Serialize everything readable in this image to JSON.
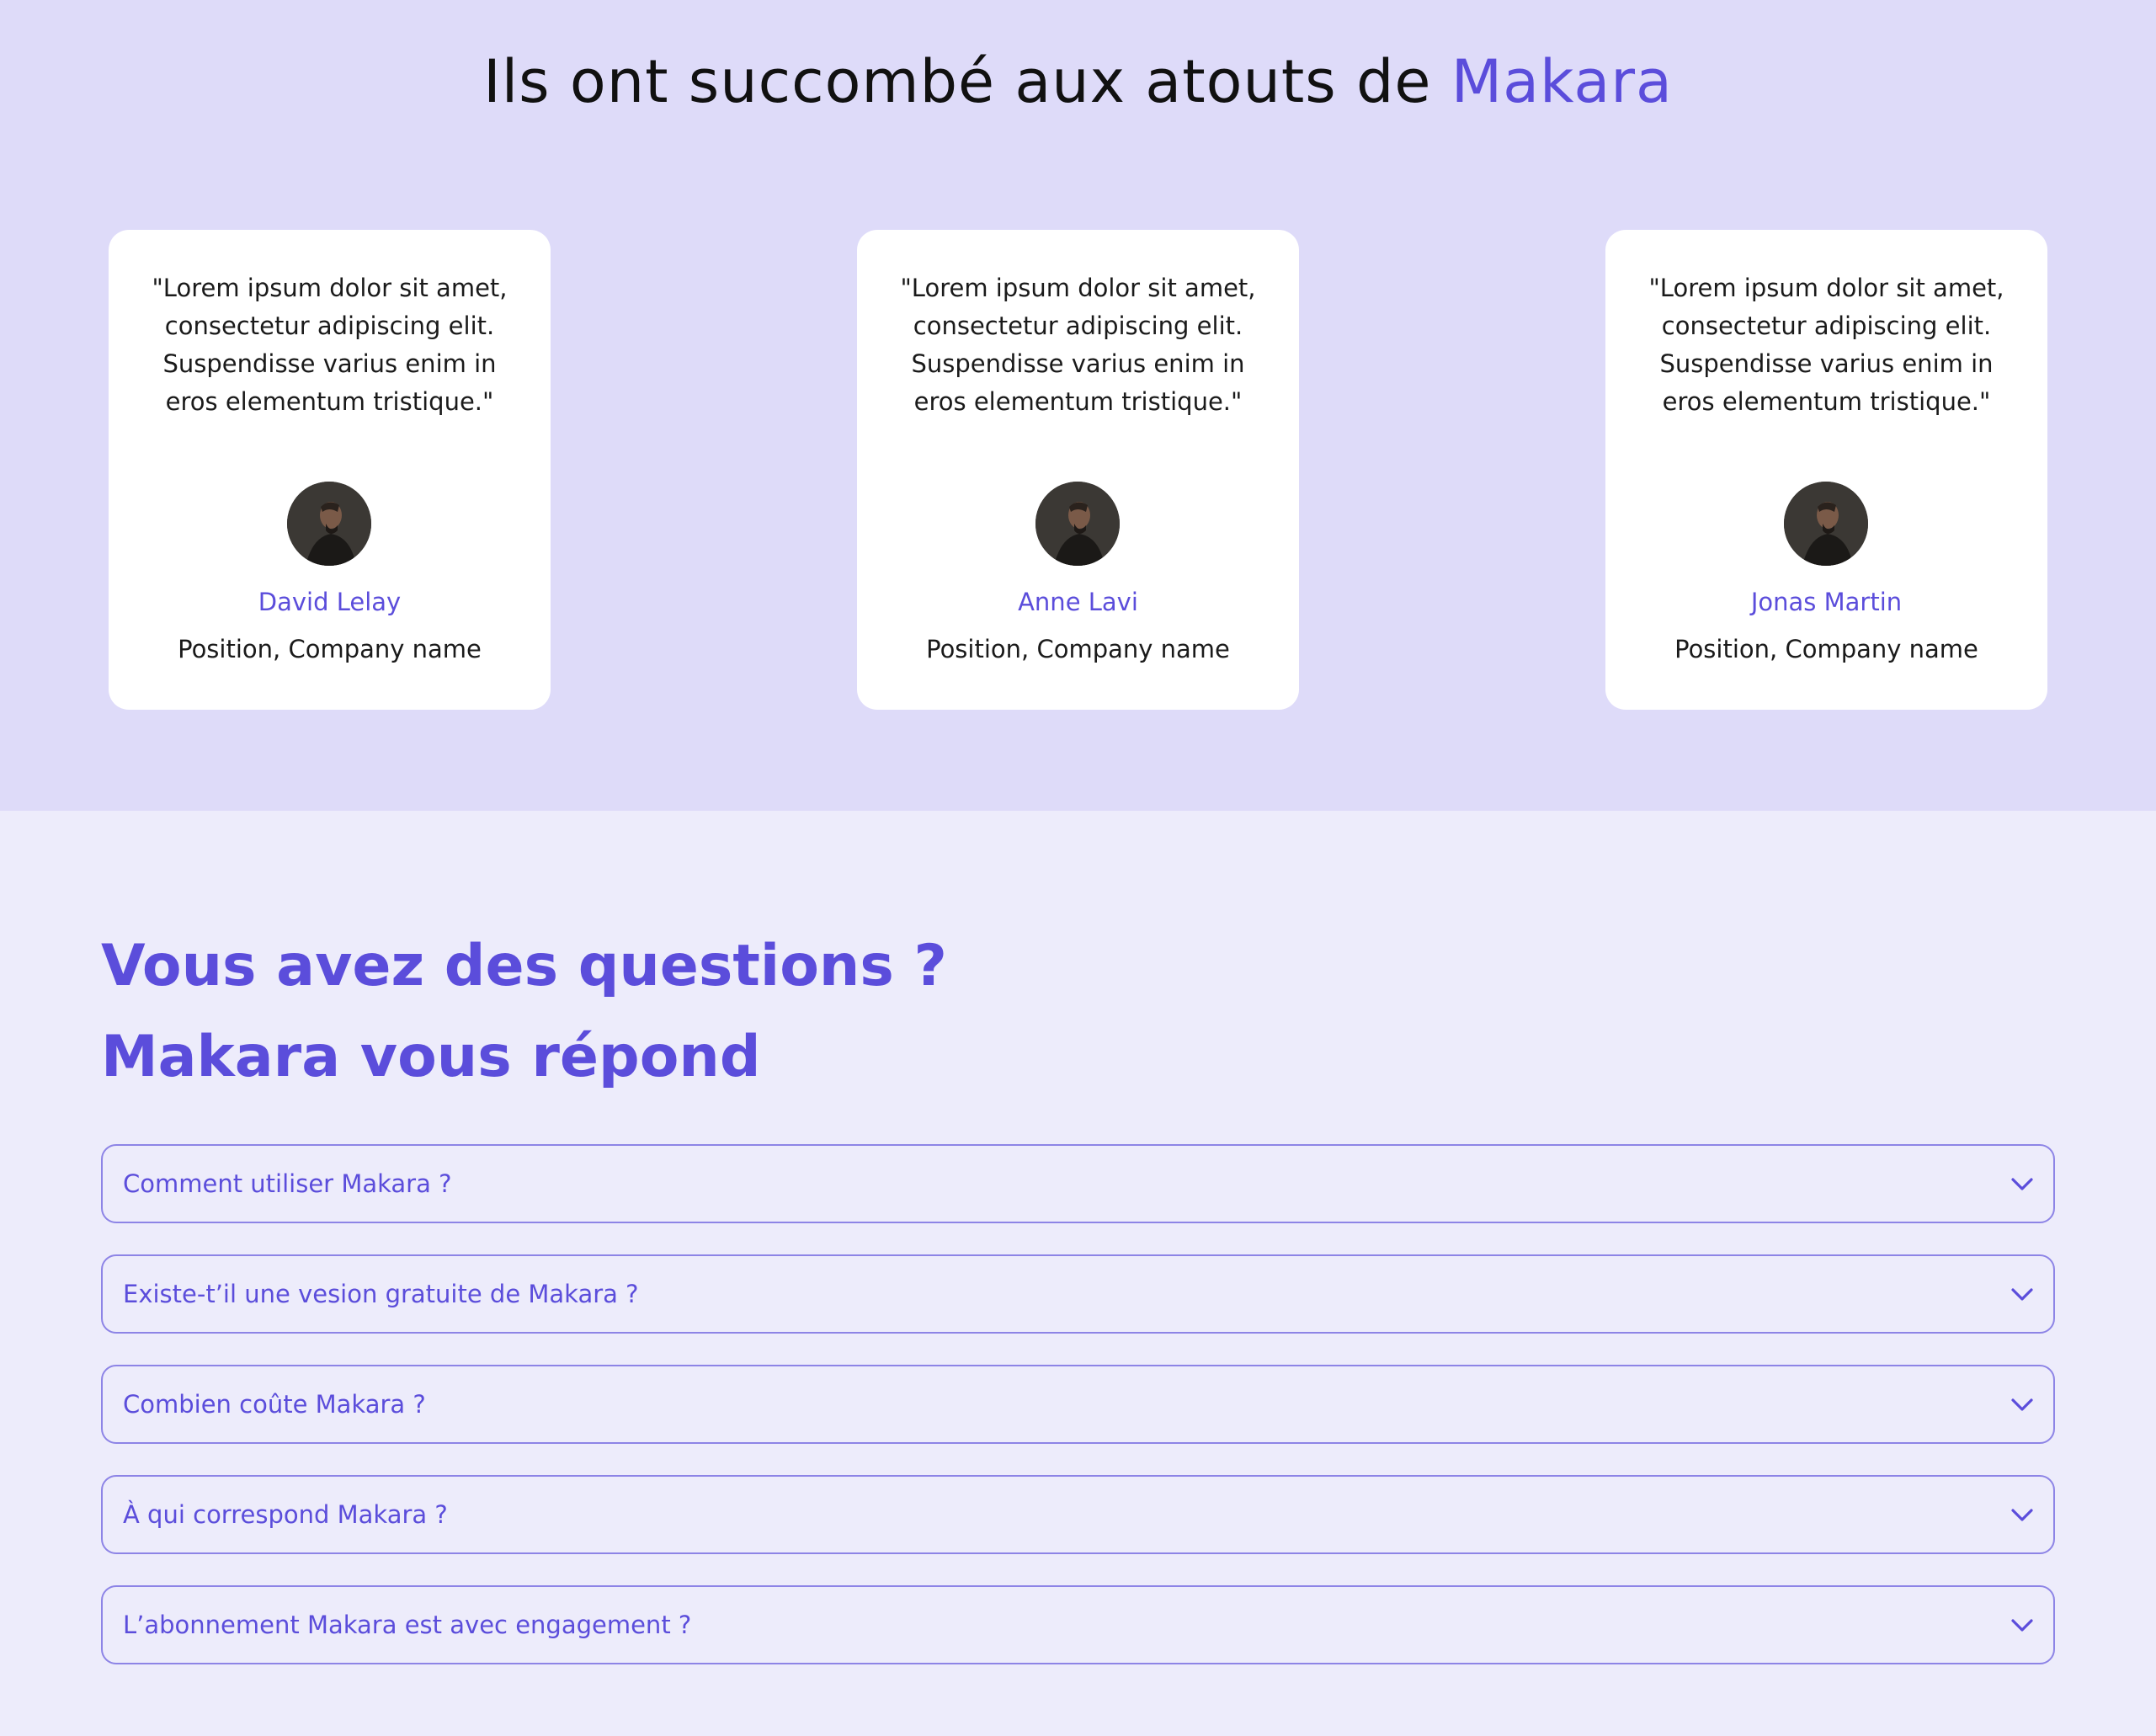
{
  "testimonials": {
    "title_prefix": "Ils ont succombé aux atouts de ",
    "title_brand": "Makara",
    "cards": [
      {
        "quote": "\"Lorem ipsum dolor sit amet, consectetur adipiscing elit. Suspendisse varius enim in eros elementum tristique.\"",
        "name": "David Lelay",
        "position": "Position, Company name"
      },
      {
        "quote": "\"Lorem ipsum dolor sit amet, consectetur adipiscing elit. Suspendisse varius enim in eros elementum tristique.\"",
        "name": "Anne Lavi",
        "position": "Position, Company name"
      },
      {
        "quote": "\"Lorem ipsum dolor sit amet, consectetur adipiscing elit. Suspendisse varius enim in eros elementum tristique.\"",
        "name": "Jonas Martin",
        "position": "Position, Company name"
      }
    ]
  },
  "faq": {
    "title_line1": "Vous avez des questions ?",
    "title_line2": "Makara vous répond",
    "items": [
      {
        "question": "Comment utiliser Makara ?",
        "icon": "chevron-down-icon"
      },
      {
        "question": "Existe-t’il une vesion gratuite de Makara ?",
        "icon": "chevron-down-icon"
      },
      {
        "question": "Combien coûte Makara ?",
        "icon": "chevron-down-icon"
      },
      {
        "question": "À qui correspond Makara ?",
        "icon": "chevron-down-icon"
      },
      {
        "question": "L’abonnement Makara est avec engagement ?",
        "icon": "chevron-down-icon"
      }
    ]
  },
  "colors": {
    "accent": "#5b4ddb",
    "testimonials_bg": "#dedbf9",
    "faq_bg": "#edecfb",
    "card_bg": "#ffffff",
    "faq_border": "#8d84e6"
  }
}
